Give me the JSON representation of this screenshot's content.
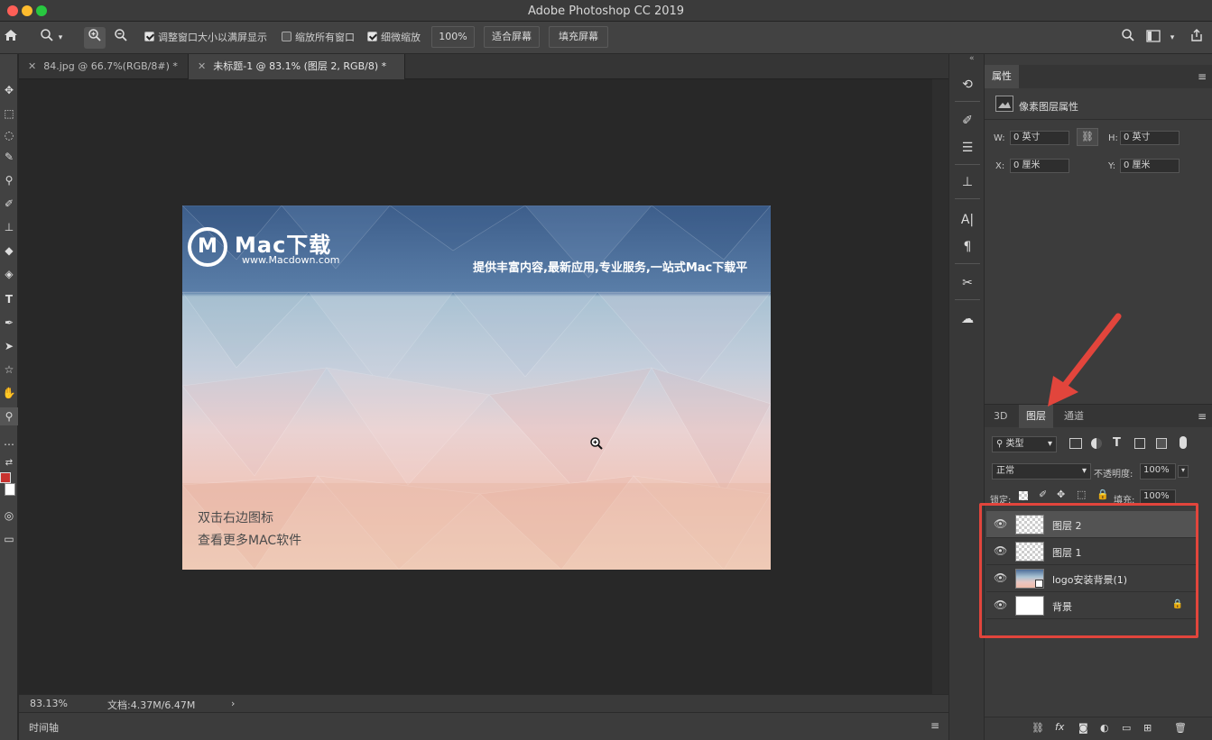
{
  "window": {
    "title": "Adobe Photoshop CC 2019"
  },
  "options_bar": {
    "checkbox_resize": "调整窗口大小以满屏显示",
    "checkbox_zoom_all": "缩放所有窗口",
    "checkbox_scrubby": "细微缩放",
    "zoom_value": "100%",
    "fit_screen": "适合屏幕",
    "fill_screen": "填充屏幕"
  },
  "tabs": [
    {
      "label": "84.jpg @ 66.7%(RGB/8#) *"
    },
    {
      "label": "未标题-1 @ 83.1% (图层 2, RGB/8) *"
    }
  ],
  "document": {
    "brand": "Mac下载",
    "brand_url": "www.Macdown.com",
    "slogan": "提供丰富内容,最新应用,专业服务,一站式Mac下载平",
    "line1": "双击右边图标",
    "line2": "查看更多MAC软件"
  },
  "status": {
    "zoom": "83.13%",
    "doc_size": "文档:4.37M/6.47M"
  },
  "timeline": {
    "label": "时间轴"
  },
  "properties": {
    "tab": "属性",
    "header": "像素图层属性",
    "w_label": "W:",
    "w_value": "0 英寸",
    "h_label": "H:",
    "h_value": "0 英寸",
    "x_label": "X:",
    "x_value": "0 厘米",
    "y_label": "Y:",
    "y_value": "0 厘米"
  },
  "layers_panel": {
    "tabs": [
      "3D",
      "图层",
      "通道"
    ],
    "filter": "类型",
    "blend_mode": "正常",
    "opacity_label": "不透明度:",
    "opacity_value": "100%",
    "lock_label": "锁定:",
    "fill_label": "填充:",
    "fill_value": "100%",
    "layers": [
      {
        "name": "图层 2",
        "selected": true
      },
      {
        "name": "图层 1",
        "selected": false
      },
      {
        "name": "logo安装背景(1)",
        "selected": false
      },
      {
        "name": "背景",
        "selected": false,
        "locked": true
      }
    ]
  },
  "colors": {
    "highlight": "#e2453c",
    "accent_macdown": "#ffffff"
  }
}
